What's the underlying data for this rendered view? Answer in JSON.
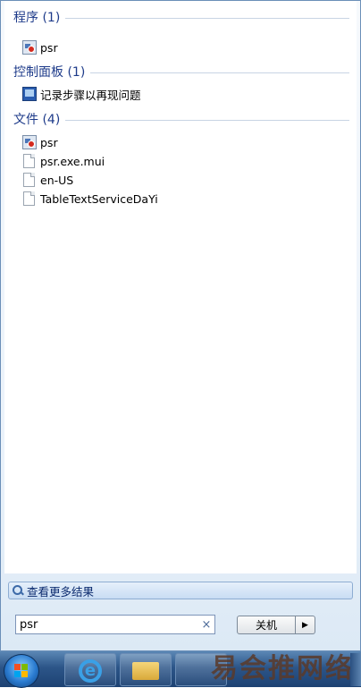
{
  "results": {
    "sections": [
      {
        "title": "程序 (1)",
        "items": [
          {
            "label": "psr",
            "icon": "psr-icon"
          }
        ]
      },
      {
        "title": "控制面板 (1)",
        "items": [
          {
            "label": "记录步骤以再现问题",
            "icon": "control-panel-icon"
          }
        ]
      },
      {
        "title": "文件 (4)",
        "items": [
          {
            "label": "psr",
            "icon": "psr-icon"
          },
          {
            "label": "psr.exe.mui",
            "icon": "file-icon"
          },
          {
            "label": "en-US",
            "icon": "file-icon"
          },
          {
            "label": "TableTextServiceDaYi",
            "icon": "file-icon"
          }
        ]
      }
    ]
  },
  "more_results": {
    "label": "查看更多结果",
    "icon": "search-icon"
  },
  "search": {
    "value": "psr",
    "clear_icon": "×"
  },
  "shutdown": {
    "label": "关机",
    "arrow": "▶"
  },
  "taskbar": {
    "ie_glyph": "e",
    "watermark": "易会推网络"
  },
  "colors": {
    "section_title": "#1e3b8a",
    "taskbar": "#2c5588"
  }
}
